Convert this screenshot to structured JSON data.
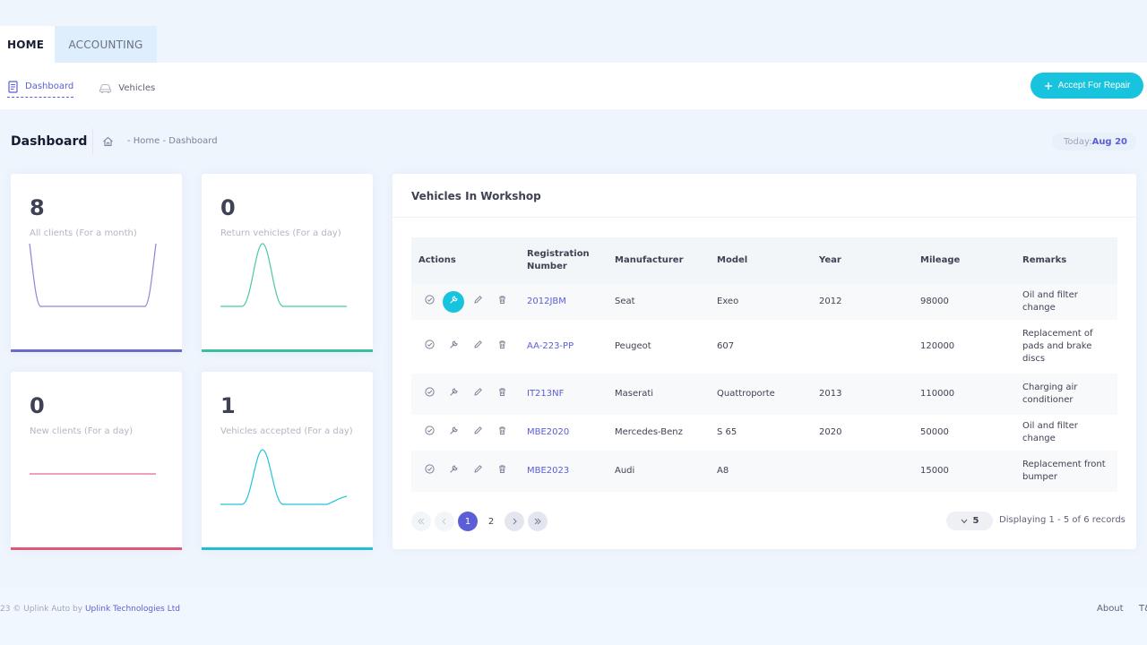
{
  "top_tabs": [
    {
      "label": "HOME",
      "active": true
    },
    {
      "label": "ACCOUNTING",
      "active": false
    }
  ],
  "subnav": {
    "dashboard": "Dashboard",
    "vehicles": "Vehicles"
  },
  "accept_button": "Accept For Repair",
  "page": {
    "title": "Dashboard",
    "breadcrumb": "- Home - Dashboard",
    "today_label": "Today:",
    "today_value": "Aug 20"
  },
  "stats": [
    {
      "value": "8",
      "label": "All clients (For a month)",
      "color": "#8b86d9"
    },
    {
      "value": "0",
      "label": "Return vehicles (For a day)",
      "color": "#4cc6a8"
    },
    {
      "value": "0",
      "label": "New clients (For a day)",
      "color": "#e46a8a"
    },
    {
      "value": "1",
      "label": "Vehicles accepted (For a day)",
      "color": "#21c3da"
    }
  ],
  "workshop": {
    "title": "Vehicles In Workshop",
    "columns": [
      "Actions",
      "Registration Number",
      "Manufacturer",
      "Model",
      "Year",
      "Mileage",
      "Remarks"
    ],
    "rows": [
      {
        "reg": "2012JBM",
        "manufacturer": "Seat",
        "model": "Exeo",
        "year": "2012",
        "mileage": "98000",
        "remarks": "Oil and filter change"
      },
      {
        "reg": "AA-223-PP",
        "manufacturer": "Peugeot",
        "model": "607",
        "year": "",
        "mileage": "120000",
        "remarks": "Replacement of pads and brake discs"
      },
      {
        "reg": "IT213NF",
        "manufacturer": "Maserati",
        "model": "Quattroporte",
        "year": "2013",
        "mileage": "110000",
        "remarks": "Charging air conditioner"
      },
      {
        "reg": "MBE2020",
        "manufacturer": "Mercedes-Benz",
        "model": "S 65",
        "year": "2020",
        "mileage": "50000",
        "remarks": "Oil and filter change"
      },
      {
        "reg": "MBE2023",
        "manufacturer": "Audi",
        "model": "A8",
        "year": "",
        "mileage": "15000",
        "remarks": "Replacement front bumper"
      }
    ],
    "pagination": {
      "pages": [
        "1",
        "2"
      ],
      "current": "1",
      "page_size": "5",
      "records_text": "Displaying 1 - 5 of 6 records"
    }
  },
  "footer": {
    "copyright": "23 © Uplink Auto by",
    "company": "Uplink Technologies Ltd",
    "about": "About",
    "tc": "T&"
  }
}
